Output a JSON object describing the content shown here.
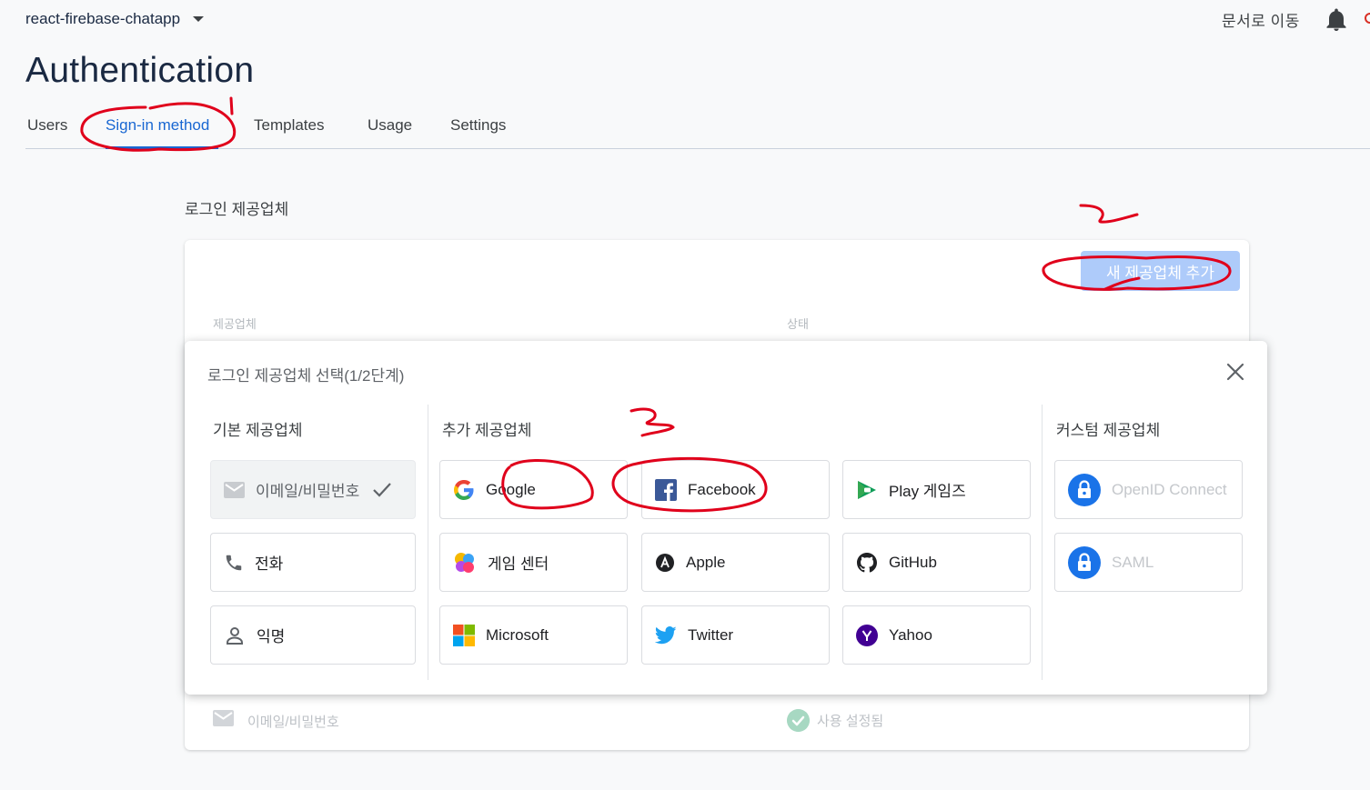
{
  "topbar": {
    "project_name": "react-firebase-chatapp",
    "docs_link": "문서로 이동"
  },
  "page": {
    "title": "Authentication"
  },
  "tabs": [
    {
      "label": "Users"
    },
    {
      "label": "Sign-in method"
    },
    {
      "label": "Templates"
    },
    {
      "label": "Usage"
    },
    {
      "label": "Settings"
    }
  ],
  "active_tab": "Sign-in method",
  "providers_section": {
    "heading": "로그인 제공업체",
    "add_button": "새 제공업체 추가",
    "columns": {
      "provider": "제공업체",
      "status": "상태"
    },
    "rows": [
      {
        "provider": "이메일/비밀번호",
        "status": "사용 설정됨"
      }
    ]
  },
  "dialog": {
    "title": "로그인 제공업체 선택(1/2단계)",
    "groups": {
      "native": {
        "label": "기본 제공업체",
        "items": [
          {
            "label": "이메일/비밀번호",
            "icon": "mail-icon",
            "enabled": true
          },
          {
            "label": "전화",
            "icon": "phone-icon"
          },
          {
            "label": "익명",
            "icon": "person-icon"
          }
        ]
      },
      "additional": {
        "label": "추가 제공업체",
        "items": [
          {
            "label": "Google",
            "icon": "google-icon"
          },
          {
            "label": "Facebook",
            "icon": "facebook-icon"
          },
          {
            "label": "Play 게임즈",
            "icon": "play-games-icon"
          },
          {
            "label": "게임 센터",
            "icon": "game-center-icon"
          },
          {
            "label": "Apple",
            "icon": "apple-icon"
          },
          {
            "label": "GitHub",
            "icon": "github-icon"
          },
          {
            "label": "Microsoft",
            "icon": "microsoft-icon"
          },
          {
            "label": "Twitter",
            "icon": "twitter-icon"
          },
          {
            "label": "Yahoo",
            "icon": "yahoo-icon"
          }
        ]
      },
      "custom": {
        "label": "커스텀 제공업체",
        "items": [
          {
            "label": "OpenID Connect",
            "icon": "lock-icon",
            "dimmed": true
          },
          {
            "label": "SAML",
            "icon": "lock-icon",
            "dimmed": true
          }
        ]
      }
    }
  },
  "colors": {
    "accent": "#1967d2",
    "add_button_bg": "#aecbfa",
    "annotation_ink": "#e0001b"
  }
}
